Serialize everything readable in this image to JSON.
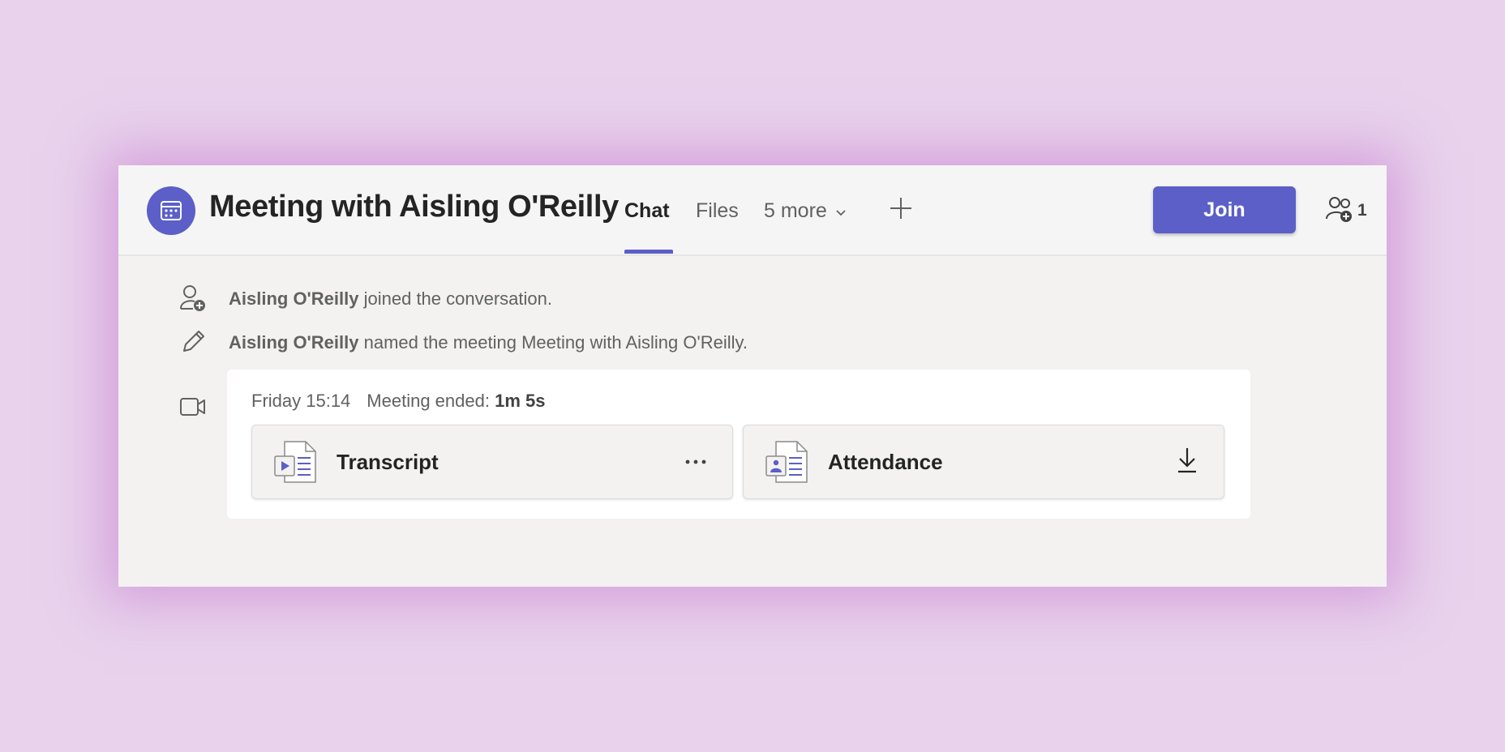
{
  "header": {
    "title": "Meeting with Aisling O'Reilly",
    "tabs": [
      {
        "label": "Chat",
        "active": true
      },
      {
        "label": "Files",
        "active": false
      },
      {
        "label": "5 more",
        "active": false
      }
    ],
    "join_label": "Join",
    "participants_count": "1",
    "icons": {
      "avatar": "calendar-icon",
      "more": "chevron-down-icon",
      "add": "plus-icon",
      "participants": "people-add-icon"
    }
  },
  "events": [
    {
      "icon": "person-add-icon",
      "actor": "Aisling O'Reilly",
      "text": " joined the conversation."
    },
    {
      "icon": "pencil-icon",
      "actor": "Aisling O'Reilly",
      "text": " named the meeting Meeting with Aisling O'Reilly."
    }
  ],
  "meeting": {
    "icon": "video-camera-icon",
    "time": "Friday 15:14",
    "ended_label": "Meeting ended: ",
    "duration": "1m 5s",
    "files": [
      {
        "name": "Transcript",
        "icon": "transcript-file-icon",
        "action_icon": "more-options-icon"
      },
      {
        "name": "Attendance",
        "icon": "attendance-file-icon",
        "action_icon": "download-icon"
      }
    ]
  },
  "colors": {
    "accent": "#5b5fc7",
    "background": "#e8d2ec",
    "window": "#f3f2f1",
    "header": "#f5f5f5"
  }
}
